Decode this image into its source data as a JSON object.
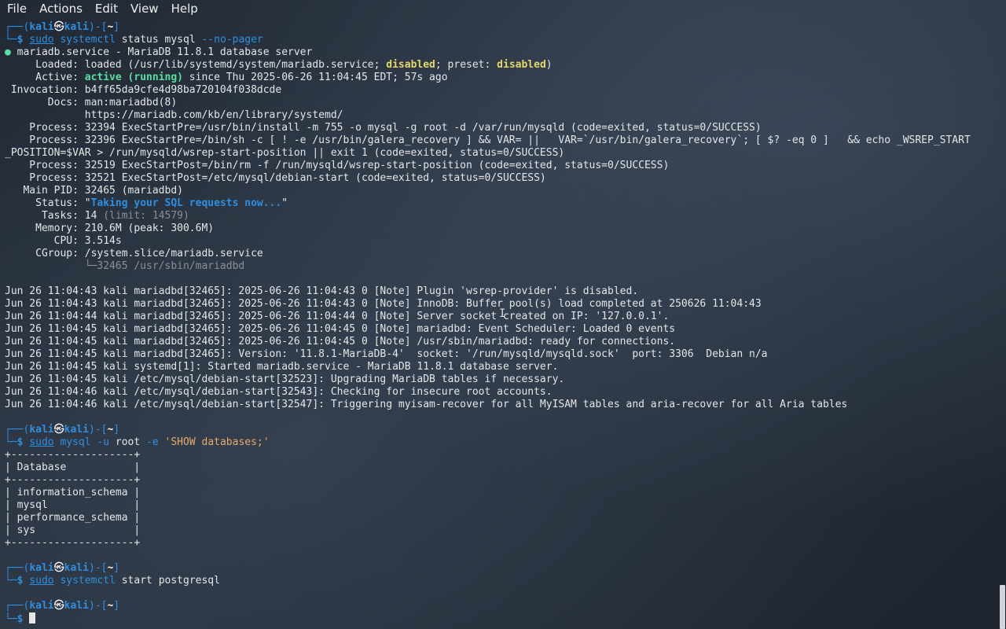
{
  "menubar": {
    "items": [
      "File",
      "Actions",
      "Edit",
      "View",
      "Help"
    ]
  },
  "prompt": {
    "open": "┌──(",
    "user": "kali",
    "at": "㉿",
    "host": "kali",
    "mid": ")-[",
    "dir": "~",
    "close": "]",
    "second": "└─",
    "dollar": "$"
  },
  "commands": [
    {
      "sudo": "sudo",
      "cmd": "systemctl",
      "args": " status mysql ",
      "opt": "--no-pager"
    },
    {
      "sudo": "sudo",
      "cmd": "mysql",
      "args": " ",
      "opt": "-u",
      "args2": " root ",
      "opt2": "-e",
      "args3": " ",
      "str": "'SHOW databases;'"
    },
    {
      "sudo": "sudo",
      "cmd": "systemctl",
      "args": " start postgresql"
    }
  ],
  "status": {
    "header_dot": "●",
    "header": " mariadb.service - MariaDB 11.8.1 database server",
    "loaded_label": "     Loaded: ",
    "loaded_a": "loaded (/usr/lib/systemd/system/mariadb.service; ",
    "loaded_disabled": "disabled",
    "loaded_b": "; preset: ",
    "loaded_preset": "disabled",
    "loaded_c": ")",
    "active_label": "     Active: ",
    "active_state": "active (running)",
    "active_rest": " since Thu 2025-06-26 11:04:45 EDT; 57s ago",
    "invocation": " Invocation: b4ff65da9cfe4d98ba720104f038dcde",
    "docs1": "       Docs: man:mariadbd(8)",
    "docs2": "             https://mariadb.com/kb/en/library/systemd/",
    "proc1": "    Process: 32394 ExecStartPre=/usr/bin/install -m 755 -o mysql -g root -d /var/run/mysqld (code=exited, status=0/SUCCESS)",
    "proc2": "    Process: 32396 ExecStartPre=/bin/sh -c [ ! -e /usr/bin/galera_recovery ] && VAR= ||   VAR=`/usr/bin/galera_recovery`; [ $? -eq 0 ]   && echo _WSREP_START",
    "proc2b": "_POSITION=$VAR > /run/mysqld/wsrep-start-position || exit 1 (code=exited, status=0/SUCCESS)",
    "proc3": "    Process: 32519 ExecStartPost=/bin/rm -f /run/mysqld/wsrep-start-position (code=exited, status=0/SUCCESS)",
    "proc4": "    Process: 32521 ExecStartPost=/etc/mysql/debian-start (code=exited, status=0/SUCCESS)",
    "mainpid": "   Main PID: 32465 (mariadbd)",
    "status_label": "     Status: \"",
    "status_text": "Taking your SQL requests now...",
    "status_end": "\"",
    "tasks_label": "      Tasks: 14 ",
    "tasks_limit": "(limit: 14579)",
    "memory": "     Memory: 210.6M (peak: 300.6M)",
    "cpu": "        CPU: 3.514s",
    "cgroup": "     CGroup: /system.slice/mariadb.service",
    "cgroup_child": "             └─32465 /usr/sbin/mariadbd"
  },
  "logs": [
    "Jun 26 11:04:43 kali mariadbd[32465]: 2025-06-26 11:04:43 0 [Note] Plugin 'wsrep-provider' is disabled.",
    "Jun 26 11:04:43 kali mariadbd[32465]: 2025-06-26 11:04:43 0 [Note] InnoDB: Buffer pool(s) load completed at 250626 11:04:43",
    "Jun 26 11:04:44 kali mariadbd[32465]: 2025-06-26 11:04:44 0 [Note] Server socket created on IP: '127.0.0.1'.",
    "Jun 26 11:04:45 kali mariadbd[32465]: 2025-06-26 11:04:45 0 [Note] mariadbd: Event Scheduler: Loaded 0 events",
    "Jun 26 11:04:45 kali mariadbd[32465]: 2025-06-26 11:04:45 0 [Note] /usr/sbin/mariadbd: ready for connections.",
    "Jun 26 11:04:45 kali mariadbd[32465]: Version: '11.8.1-MariaDB-4'  socket: '/run/mysqld/mysqld.sock'  port: 3306  Debian n/a",
    "Jun 26 11:04:45 kali systemd[1]: Started mariadb.service - MariaDB 11.8.1 database server.",
    "Jun 26 11:04:45 kali /etc/mysql/debian-start[32523]: Upgrading MariaDB tables if necessary.",
    "Jun 26 11:04:46 kali /etc/mysql/debian-start[32543]: Checking for insecure root accounts.",
    "Jun 26 11:04:46 kali /etc/mysql/debian-start[32547]: Triggering myisam-recover for all MyISAM tables and aria-recover for all Aria tables"
  ],
  "db_table": {
    "border": "+--------------------+",
    "header": "| Database           |",
    "rows": [
      "| information_schema |",
      "| mysql              |",
      "| performance_schema |",
      "| sys                |"
    ]
  }
}
